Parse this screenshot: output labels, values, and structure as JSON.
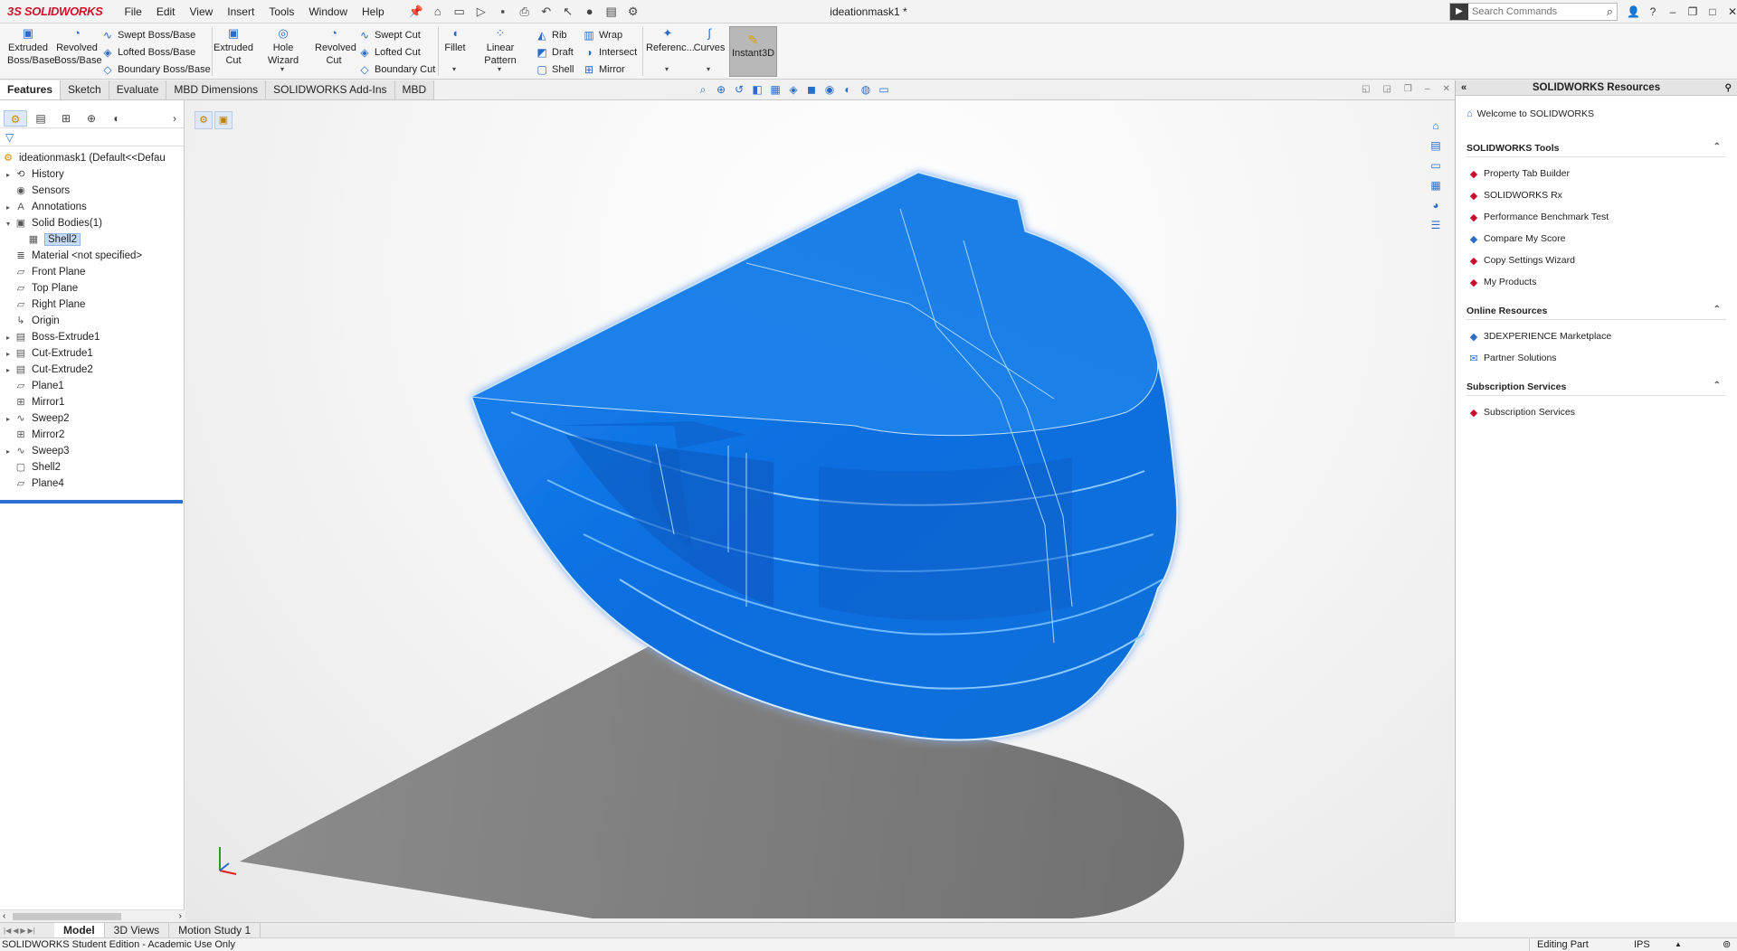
{
  "app": {
    "brand": "SOLIDWORKS",
    "doc_title": "ideationmask1 *",
    "menu": [
      "File",
      "Edit",
      "View",
      "Insert",
      "Tools",
      "Window",
      "Help"
    ],
    "search_placeholder": "Search Commands"
  },
  "commands": {
    "extruded_boss": "Extruded\nBoss/Base",
    "revolved_boss": "Revolved\nBoss/Base",
    "swept_boss": "Swept Boss/Base",
    "lofted_boss": "Lofted Boss/Base",
    "boundary_boss": "Boundary Boss/Base",
    "extruded_cut": "Extruded\nCut",
    "hole_wizard": "Hole Wizard",
    "revolved_cut": "Revolved\nCut",
    "swept_cut": "Swept Cut",
    "lofted_cut": "Lofted Cut",
    "boundary_cut": "Boundary Cut",
    "fillet": "Fillet",
    "linear_pattern": "Linear Pattern",
    "rib": "Rib",
    "draft": "Draft",
    "shell": "Shell",
    "wrap": "Wrap",
    "intersect": "Intersect",
    "mirror": "Mirror",
    "reference": "Referenc...",
    "curves": "Curves",
    "instant3d": "Instant3D"
  },
  "tabs": [
    "Features",
    "Sketch",
    "Evaluate",
    "MBD Dimensions",
    "SOLIDWORKS Add-Ins",
    "MBD"
  ],
  "tree": {
    "root": "ideationmask1  (Default<<Defau",
    "items": [
      {
        "label": "History",
        "caret": "▸",
        "icon": "history-icon",
        "glyph": "⟲",
        "indent": 0
      },
      {
        "label": "Sensors",
        "caret": "",
        "icon": "sensors-icon",
        "glyph": "◉",
        "indent": 0
      },
      {
        "label": "Annotations",
        "caret": "▸",
        "icon": "annotations-icon",
        "glyph": "A",
        "indent": 0
      },
      {
        "label": "Solid Bodies(1)",
        "caret": "▾",
        "icon": "solid-bodies-icon",
        "glyph": "▣",
        "indent": 0
      },
      {
        "label": "Shell2",
        "caret": "",
        "icon": "body-icon",
        "glyph": "▦",
        "indent": 1,
        "selected": true
      },
      {
        "label": "Material <not specified>",
        "caret": "",
        "icon": "material-icon",
        "glyph": "≣",
        "indent": 0
      },
      {
        "label": "Front Plane",
        "caret": "",
        "icon": "plane-icon",
        "glyph": "▱",
        "indent": 0
      },
      {
        "label": "Top Plane",
        "caret": "",
        "icon": "plane-icon",
        "glyph": "▱",
        "indent": 0
      },
      {
        "label": "Right Plane",
        "caret": "",
        "icon": "plane-icon",
        "glyph": "▱",
        "indent": 0
      },
      {
        "label": "Origin",
        "caret": "",
        "icon": "origin-icon",
        "glyph": "↳",
        "indent": 0
      },
      {
        "label": "Boss-Extrude1",
        "caret": "▸",
        "icon": "extrude-icon",
        "glyph": "▤",
        "indent": 0
      },
      {
        "label": "Cut-Extrude1",
        "caret": "▸",
        "icon": "cut-extrude-icon",
        "glyph": "▤",
        "indent": 0
      },
      {
        "label": "Cut-Extrude2",
        "caret": "▸",
        "icon": "cut-extrude-icon",
        "glyph": "▤",
        "indent": 0
      },
      {
        "label": "Plane1",
        "caret": "",
        "icon": "plane-icon",
        "glyph": "▱",
        "indent": 0
      },
      {
        "label": "Mirror1",
        "caret": "",
        "icon": "mirror-icon",
        "glyph": "⊞",
        "indent": 0
      },
      {
        "label": "Sweep2",
        "caret": "▸",
        "icon": "sweep-icon",
        "glyph": "∿",
        "indent": 0
      },
      {
        "label": "Mirror2",
        "caret": "",
        "icon": "mirror-icon",
        "glyph": "⊞",
        "indent": 0
      },
      {
        "label": "Sweep3",
        "caret": "▸",
        "icon": "sweep-icon",
        "glyph": "∿",
        "indent": 0
      },
      {
        "label": "Shell2",
        "caret": "",
        "icon": "shell-icon",
        "glyph": "▢",
        "indent": 0
      },
      {
        "label": "Plane4",
        "caret": "",
        "icon": "plane-icon",
        "glyph": "▱",
        "indent": 0
      }
    ]
  },
  "resources": {
    "title": "SOLIDWORKS Resources",
    "welcome": "Welcome to SOLIDWORKS",
    "sections": [
      {
        "title": "SOLIDWORKS Tools",
        "items": [
          "Property Tab Builder",
          "SOLIDWORKS Rx",
          "Performance Benchmark Test",
          "Compare My Score",
          "Copy Settings Wizard",
          "My Products"
        ]
      },
      {
        "title": "Online Resources",
        "items": [
          "3DEXPERIENCE Marketplace",
          "Partner Solutions"
        ]
      },
      {
        "title": "Subscription Services",
        "items": [
          "Subscription Services"
        ]
      }
    ]
  },
  "bottom_tabs": [
    "Model",
    "3D Views",
    "Motion Study 1"
  ],
  "status": {
    "left": "SOLIDWORKS Student Edition - Academic Use Only",
    "mode": "Editing Part",
    "units": "IPS"
  },
  "colors": {
    "model_blue": "#0a6fe0",
    "brand_red": "#d2112c",
    "selection": "#c6dcf5"
  }
}
